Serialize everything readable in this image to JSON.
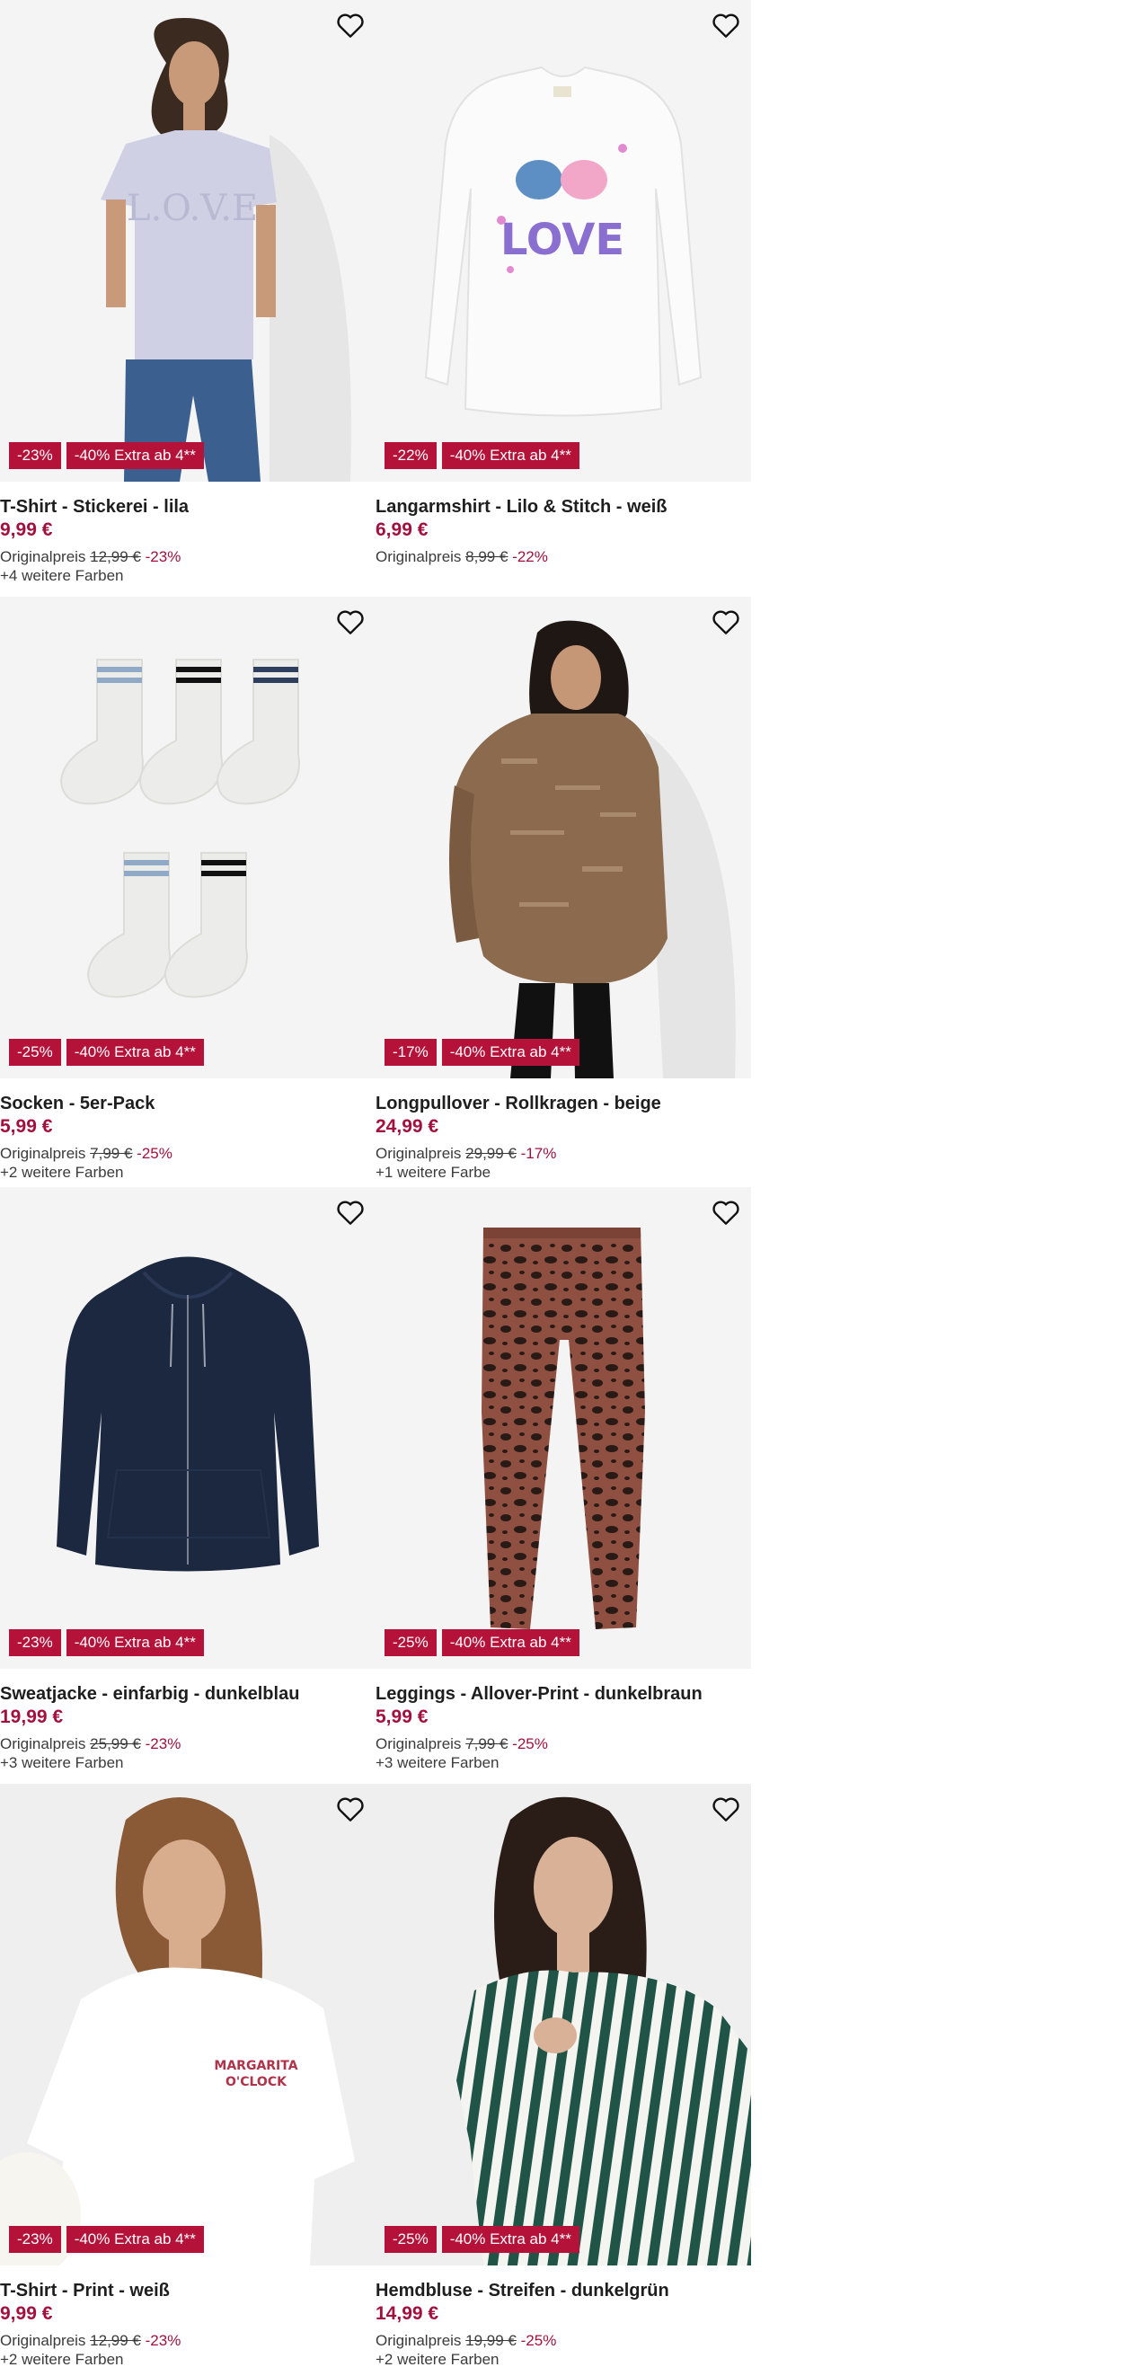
{
  "accent_color": "#b5123a",
  "price_color": "#a3103d",
  "wishlist_icon": "heart-outline-icon",
  "products": [
    {
      "title": "T-Shirt - Stickerei - lila",
      "price": "9,99 €",
      "orig_label": "Originalpreis",
      "orig_price": "12,99 €",
      "orig_discount": "-23%",
      "colors": "+4 weitere Farben",
      "badge_discount": "-23%",
      "badge_extra": "-40% Extra ab 4**",
      "image": "woman-in-lilac-tshirt"
    },
    {
      "title": "Langarmshirt - Lilo & Stitch - weiß",
      "price": "6,99 €",
      "orig_label": "Originalpreis",
      "orig_price": "8,99 €",
      "orig_discount": "-22%",
      "colors": "",
      "badge_discount": "-22%",
      "badge_extra": "-40% Extra ab 4**",
      "image": "white-longsleeve-love-print"
    },
    {
      "title": "Socken - 5er-Pack",
      "price": "5,99 €",
      "orig_label": "Originalpreis",
      "orig_price": "7,99 €",
      "orig_discount": "-25%",
      "colors": "+2 weitere Farben",
      "badge_discount": "-25%",
      "badge_extra": "-40% Extra ab 4**",
      "image": "striped-socks"
    },
    {
      "title": "Longpullover - Rollkragen - beige",
      "price": "24,99 €",
      "orig_label": "Originalpreis",
      "orig_price": "29,99 €",
      "orig_discount": "-17%",
      "colors": "+1 weitere Farbe",
      "badge_discount": "-17%",
      "badge_extra": "-40% Extra ab 4**",
      "image": "woman-in-knit-pullover"
    },
    {
      "title": "Sweatjacke - einfarbig - dunkelblau",
      "price": "19,99 €",
      "orig_label": "Originalpreis",
      "orig_price": "25,99 €",
      "orig_discount": "-23%",
      "colors": "+3 weitere Farben",
      "badge_discount": "-23%",
      "badge_extra": "-40% Extra ab 4**",
      "image": "navy-zip-hoodie"
    },
    {
      "title": "Leggings - Allover-Print - dunkelbraun",
      "price": "5,99 €",
      "orig_label": "Originalpreis",
      "orig_price": "7,99 €",
      "orig_discount": "-25%",
      "colors": "+3 weitere Farben",
      "badge_discount": "-25%",
      "badge_extra": "-40% Extra ab 4**",
      "image": "leopard-leggings"
    },
    {
      "title": "T-Shirt - Print - weiß",
      "price": "9,99 €",
      "orig_label": "Originalpreis",
      "orig_price": "12,99 €",
      "orig_discount": "-23%",
      "colors": "+2 weitere Farben",
      "badge_discount": "-23%",
      "badge_extra": "-40% Extra ab 4**",
      "image": "woman-in-white-print-tshirt",
      "print_text": [
        "MARGARITA",
        "O'CLOCK"
      ]
    },
    {
      "title": "Hemdbluse - Streifen - dunkelgrün",
      "price": "14,99 €",
      "orig_label": "Originalpreis",
      "orig_price": "19,99 €",
      "orig_discount": "-25%",
      "colors": "+2 weitere Farben",
      "badge_discount": "-25%",
      "badge_extra": "-40% Extra ab 4**",
      "image": "woman-in-green-striped-blouse"
    }
  ]
}
